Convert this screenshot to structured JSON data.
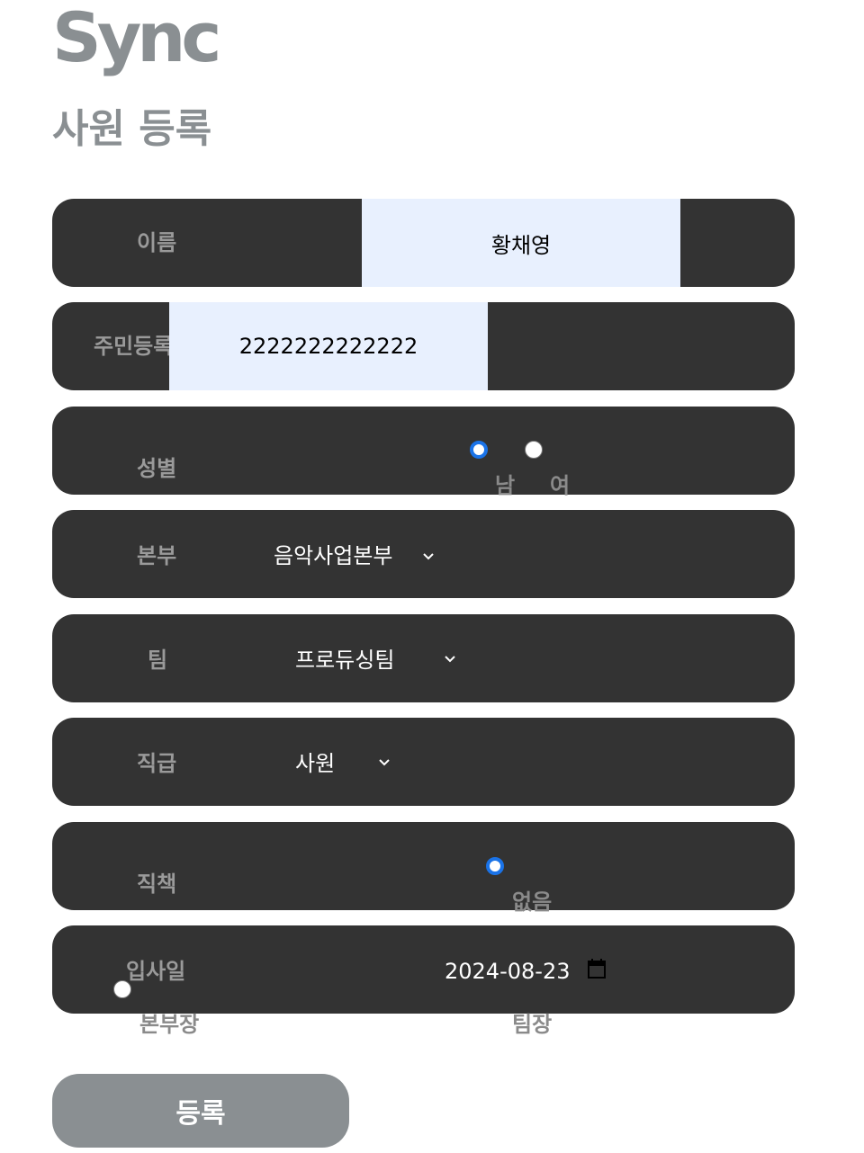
{
  "app": {
    "logo": "Sync"
  },
  "page": {
    "title": "사원 등록"
  },
  "form": {
    "name": {
      "label": "이름",
      "value": "황채영"
    },
    "ssn": {
      "label": "주민등록",
      "value": "2222222222222"
    },
    "gender": {
      "label": "성별",
      "options": [
        "남",
        "여"
      ],
      "selected": "남"
    },
    "division": {
      "label": "본부",
      "value": "음악사업본부"
    },
    "team": {
      "label": "팀",
      "value": "프로듀싱팀"
    },
    "rank": {
      "label": "직급",
      "value": "사원"
    },
    "duty": {
      "label": "직책",
      "options": [
        "없음",
        "본부장",
        "팀장"
      ],
      "selected": "없음"
    },
    "hire_date": {
      "label": "입사일",
      "value": "2024-08-23"
    }
  },
  "submit_label": "등록",
  "colors": {
    "row_bg": "#333333",
    "input_bg": "#e8f0fe",
    "accent": "#1a73e8",
    "muted": "#8a8f92"
  },
  "icons": [
    "chevron-down-icon",
    "calendar-icon"
  ]
}
